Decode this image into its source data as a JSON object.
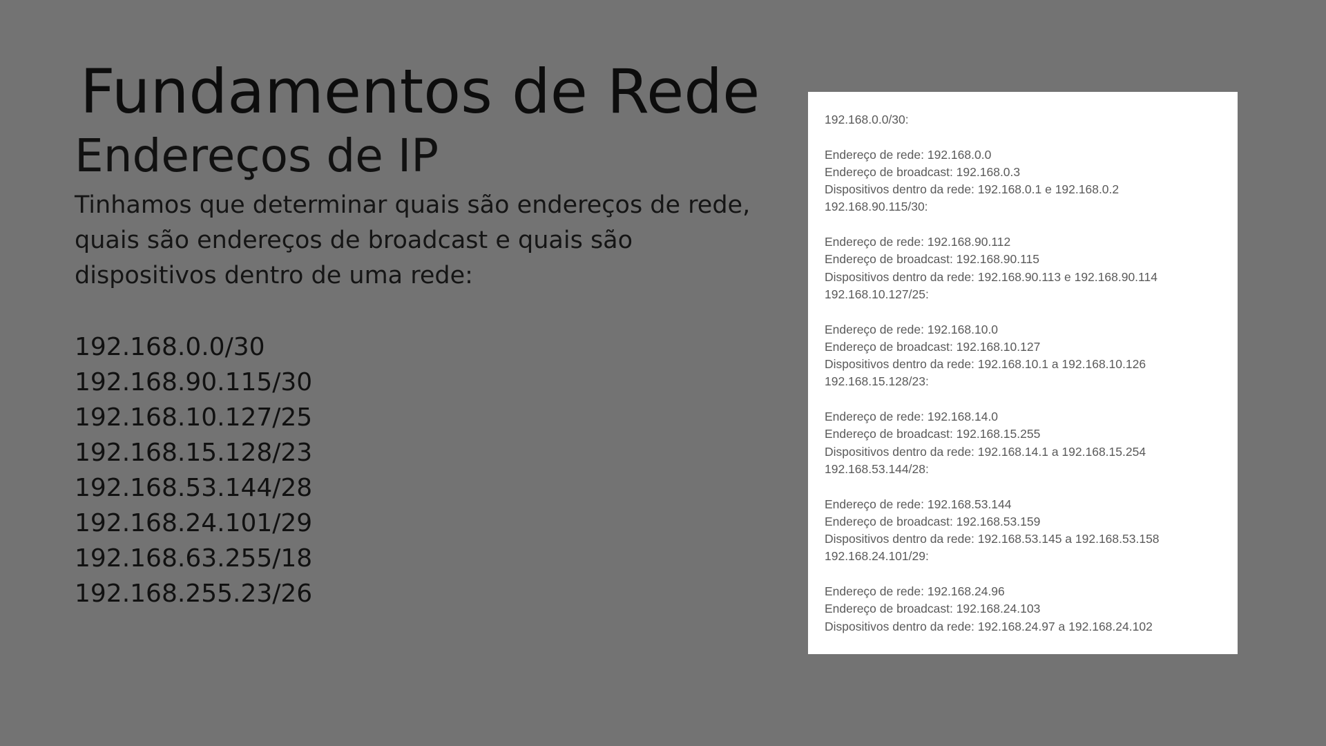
{
  "slide": {
    "title": "Fundamentos de Rede",
    "subtitle": "Endereços de IP",
    "intro": "Tinhamos que determinar quais são endereços de rede, quais são endereços de broadcast e quais são dispositivos dentro de uma rede:",
    "ip_list": [
      "192.168.0.0/30",
      "192.168.90.115/30",
      "192.168.10.127/25",
      "192.168.15.128/23",
      "192.168.53.144/28",
      "192.168.24.101/29",
      "192.168.63.255/18",
      "192.168.255.23/26"
    ]
  },
  "answers": {
    "lines": [
      "192.168.0.0/30:",
      "",
      "Endereço de rede: 192.168.0.0",
      "Endereço de broadcast: 192.168.0.3",
      "Dispositivos dentro da rede: 192.168.0.1 e 192.168.0.2",
      "192.168.90.115/30:",
      "",
      "Endereço de rede: 192.168.90.112",
      "Endereço de broadcast: 192.168.90.115",
      "Dispositivos dentro da rede: 192.168.90.113 e 192.168.90.114",
      "192.168.10.127/25:",
      "",
      "Endereço de rede: 192.168.10.0",
      "Endereço de broadcast: 192.168.10.127",
      "Dispositivos dentro da rede: 192.168.10.1 a 192.168.10.126",
      "192.168.15.128/23:",
      "",
      "Endereço de rede: 192.168.14.0",
      "Endereço de broadcast: 192.168.15.255",
      "Dispositivos dentro da rede: 192.168.14.1 a 192.168.15.254",
      "192.168.53.144/28:",
      "",
      "Endereço de rede: 192.168.53.144",
      "Endereço de broadcast: 192.168.53.159",
      "Dispositivos dentro da rede: 192.168.53.145 a 192.168.53.158",
      "192.168.24.101/29:",
      "",
      "Endereço de rede: 192.168.24.96",
      "Endereço de broadcast: 192.168.24.103",
      "Dispositivos dentro da rede: 192.168.24.97 a 192.168.24.102"
    ]
  },
  "colors": {
    "background": "#737373",
    "card": "#ffffff",
    "text": "#111111",
    "card_text": "#5a5a5a"
  }
}
